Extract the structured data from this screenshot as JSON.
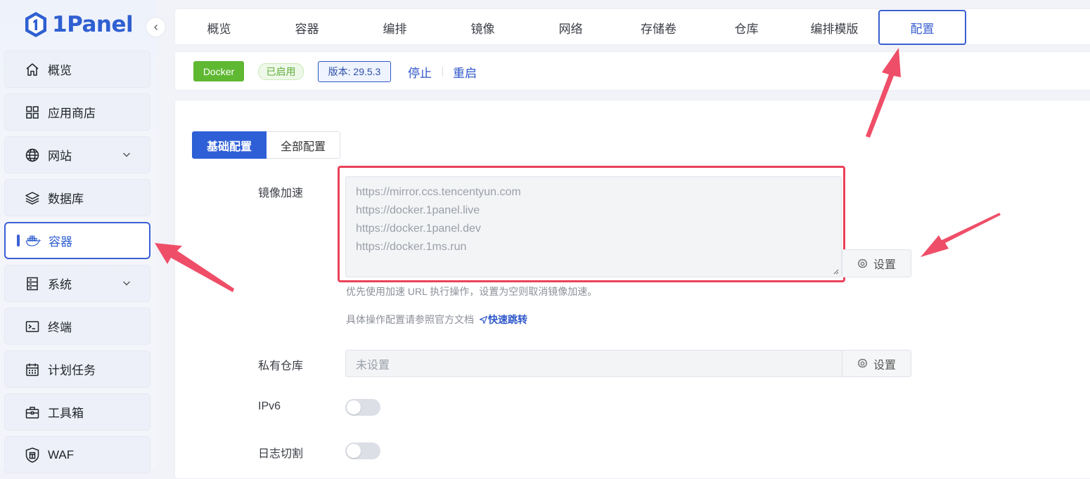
{
  "app": {
    "logo_text": "1Panel"
  },
  "sidebar": {
    "items": [
      {
        "label": "概览",
        "icon": "home-icon"
      },
      {
        "label": "应用商店",
        "icon": "apps-grid-icon"
      },
      {
        "label": "网站",
        "icon": "globe-icon",
        "expandable": true
      },
      {
        "label": "数据库",
        "icon": "layers-icon"
      },
      {
        "label": "容器",
        "icon": "docker-icon",
        "active": true
      },
      {
        "label": "系统",
        "icon": "server-icon",
        "expandable": true
      },
      {
        "label": "终端",
        "icon": "terminal-icon"
      },
      {
        "label": "计划任务",
        "icon": "calendar-icon"
      },
      {
        "label": "工具箱",
        "icon": "toolbox-icon"
      },
      {
        "label": "WAF",
        "icon": "shield-icon"
      }
    ]
  },
  "tabs": [
    {
      "label": "概览"
    },
    {
      "label": "容器"
    },
    {
      "label": "编排"
    },
    {
      "label": "镜像"
    },
    {
      "label": "网络"
    },
    {
      "label": "存储卷"
    },
    {
      "label": "仓库"
    },
    {
      "label": "编排模版"
    },
    {
      "label": "配置",
      "active": true
    }
  ],
  "status": {
    "docker_tag": "Docker",
    "enabled_tag": "已启用",
    "version_tag": "版本: 29.5.3",
    "stop_label": "停止",
    "restart_label": "重启"
  },
  "config": {
    "segments": {
      "basic": "基础配置",
      "all": "全部配置",
      "selected": "basic"
    },
    "mirror": {
      "label": "镜像加速",
      "lines": [
        "https://mirror.ccs.tencentyun.com",
        "https://docker.1panel.live",
        "https://docker.1panel.dev",
        "https://docker.1ms.run"
      ],
      "set_label": "设置",
      "help": "优先使用加速 URL 执行操作，设置为空则取消镜像加速。",
      "doc_text": "具体操作配置请参照官方文档",
      "quick_link": "快速跳转"
    },
    "private_registry": {
      "label": "私有仓库",
      "placeholder": "未设置",
      "set_label": "设置"
    },
    "ipv6": {
      "label": "IPv6",
      "enabled": false
    },
    "log_rotate": {
      "label": "日志切割",
      "enabled": false
    }
  },
  "colors": {
    "primary": "#2f5fd6",
    "annotation_red": "#ea4259",
    "docker_green": "#5fb832"
  }
}
